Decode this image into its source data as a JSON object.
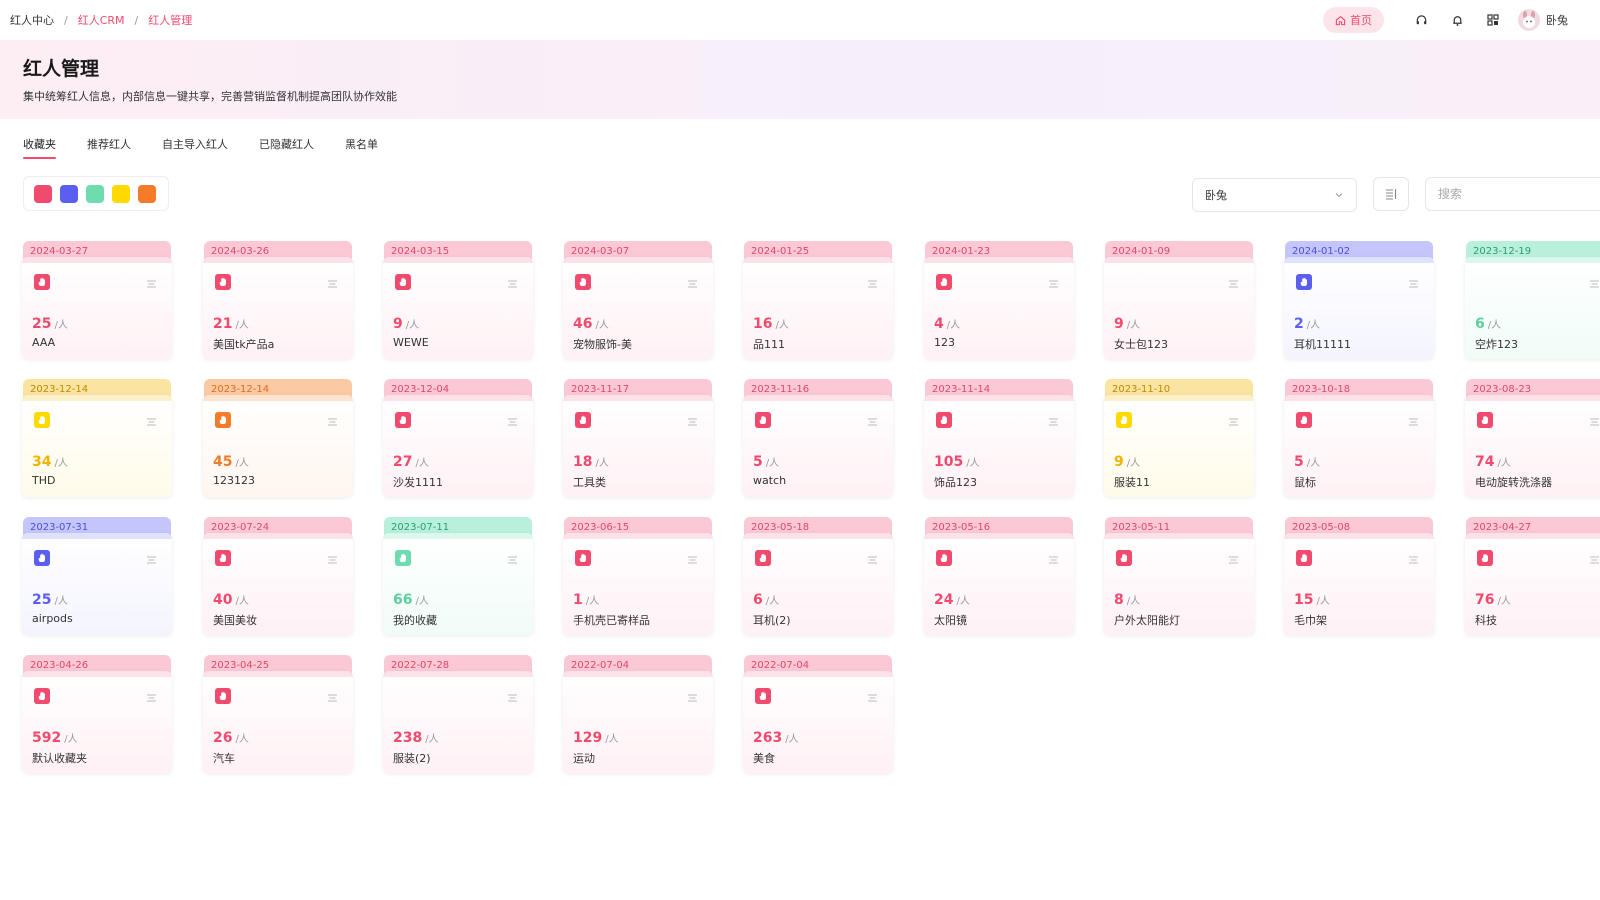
{
  "breadcrumb": [
    "红人中心",
    "红人CRM",
    "红人管理"
  ],
  "header": {
    "home_label": "首页",
    "user_name": "卧兔"
  },
  "hero": {
    "title": "红人管理",
    "subtitle": "集中统筹红人信息，内部信息一键共享，完善营销监督机制提高团队协作效能"
  },
  "tabs": [
    "收藏夹",
    "推荐红人",
    "自主导入红人",
    "已隐藏红人",
    "黑名单"
  ],
  "active_tab": 0,
  "color_filters": [
    "#f04a6e",
    "#5b5ff0",
    "#6fdcb0",
    "#ffd900",
    "#f47b2a"
  ],
  "owner_select": "卧兔",
  "search_placeholder": "搜索",
  "unit_label": "/人",
  "folders": [
    {
      "date": "2024-03-27",
      "count": "25",
      "name": "AAA",
      "color": "pink",
      "icon": true
    },
    {
      "date": "2024-03-26",
      "count": "21",
      "name": "美国tk产品a",
      "color": "pink",
      "icon": true
    },
    {
      "date": "2024-03-15",
      "count": "9",
      "name": "WEWE",
      "color": "pink",
      "icon": true
    },
    {
      "date": "2024-03-07",
      "count": "46",
      "name": "宠物服饰-美",
      "color": "pink",
      "icon": true
    },
    {
      "date": "2024-01-25",
      "count": "16",
      "name": "品111",
      "color": "pink",
      "icon": false
    },
    {
      "date": "2024-01-23",
      "count": "4",
      "name": "123",
      "color": "pink",
      "icon": true
    },
    {
      "date": "2024-01-09",
      "count": "9",
      "name": "女士包123",
      "color": "pink",
      "icon": false
    },
    {
      "date": "2024-01-02",
      "count": "2",
      "name": "耳机11111",
      "color": "blue",
      "icon": true
    },
    {
      "date": "2023-12-19",
      "count": "6",
      "name": "空炸123",
      "color": "green",
      "icon": false
    },
    {
      "date": "2023-12-14",
      "count": "34",
      "name": "THD",
      "color": "yellow",
      "icon": true
    },
    {
      "date": "2023-12-14",
      "count": "45",
      "name": "123123",
      "color": "orange",
      "icon": true
    },
    {
      "date": "2023-12-04",
      "count": "27",
      "name": "沙发1111",
      "color": "pink",
      "icon": true
    },
    {
      "date": "2023-11-17",
      "count": "18",
      "name": "工具类",
      "color": "pink",
      "icon": true
    },
    {
      "date": "2023-11-16",
      "count": "5",
      "name": "watch",
      "color": "pink",
      "icon": true
    },
    {
      "date": "2023-11-14",
      "count": "105",
      "name": "饰品123",
      "color": "pink",
      "icon": true
    },
    {
      "date": "2023-11-10",
      "count": "9",
      "name": "服装11",
      "color": "yellow",
      "icon": true
    },
    {
      "date": "2023-10-18",
      "count": "5",
      "name": "鼠标",
      "color": "pink",
      "icon": true
    },
    {
      "date": "2023-08-23",
      "count": "74",
      "name": "电动旋转洗涤器",
      "color": "pink",
      "icon": true
    },
    {
      "date": "2023-07-31",
      "count": "25",
      "name": "airpods",
      "color": "blue",
      "icon": true
    },
    {
      "date": "2023-07-24",
      "count": "40",
      "name": "美国美妆",
      "color": "pink",
      "icon": true
    },
    {
      "date": "2023-07-11",
      "count": "66",
      "name": "我的收藏",
      "color": "green",
      "icon": true
    },
    {
      "date": "2023-06-15",
      "count": "1",
      "name": "手机壳已寄样品",
      "color": "pink",
      "icon": true
    },
    {
      "date": "2023-05-18",
      "count": "6",
      "name": "耳机(2)",
      "color": "pink",
      "icon": true
    },
    {
      "date": "2023-05-16",
      "count": "24",
      "name": "太阳镜",
      "color": "pink",
      "icon": true
    },
    {
      "date": "2023-05-11",
      "count": "8",
      "name": "户外太阳能灯",
      "color": "pink",
      "icon": true
    },
    {
      "date": "2023-05-08",
      "count": "15",
      "name": "毛巾架",
      "color": "pink",
      "icon": true
    },
    {
      "date": "2023-04-27",
      "count": "76",
      "name": "科技",
      "color": "pink",
      "icon": true
    },
    {
      "date": "2023-04-26",
      "count": "592",
      "name": "默认收藏夹",
      "color": "pink",
      "icon": true
    },
    {
      "date": "2023-04-25",
      "count": "26",
      "name": "汽车",
      "color": "pink",
      "icon": true
    },
    {
      "date": "2022-07-28",
      "count": "238",
      "name": "服装(2)",
      "color": "pink",
      "icon": false
    },
    {
      "date": "2022-07-04",
      "count": "129",
      "name": "运动",
      "color": "pink",
      "icon": false
    },
    {
      "date": "2022-07-04",
      "count": "263",
      "name": "美食",
      "color": "pink",
      "icon": true
    }
  ]
}
